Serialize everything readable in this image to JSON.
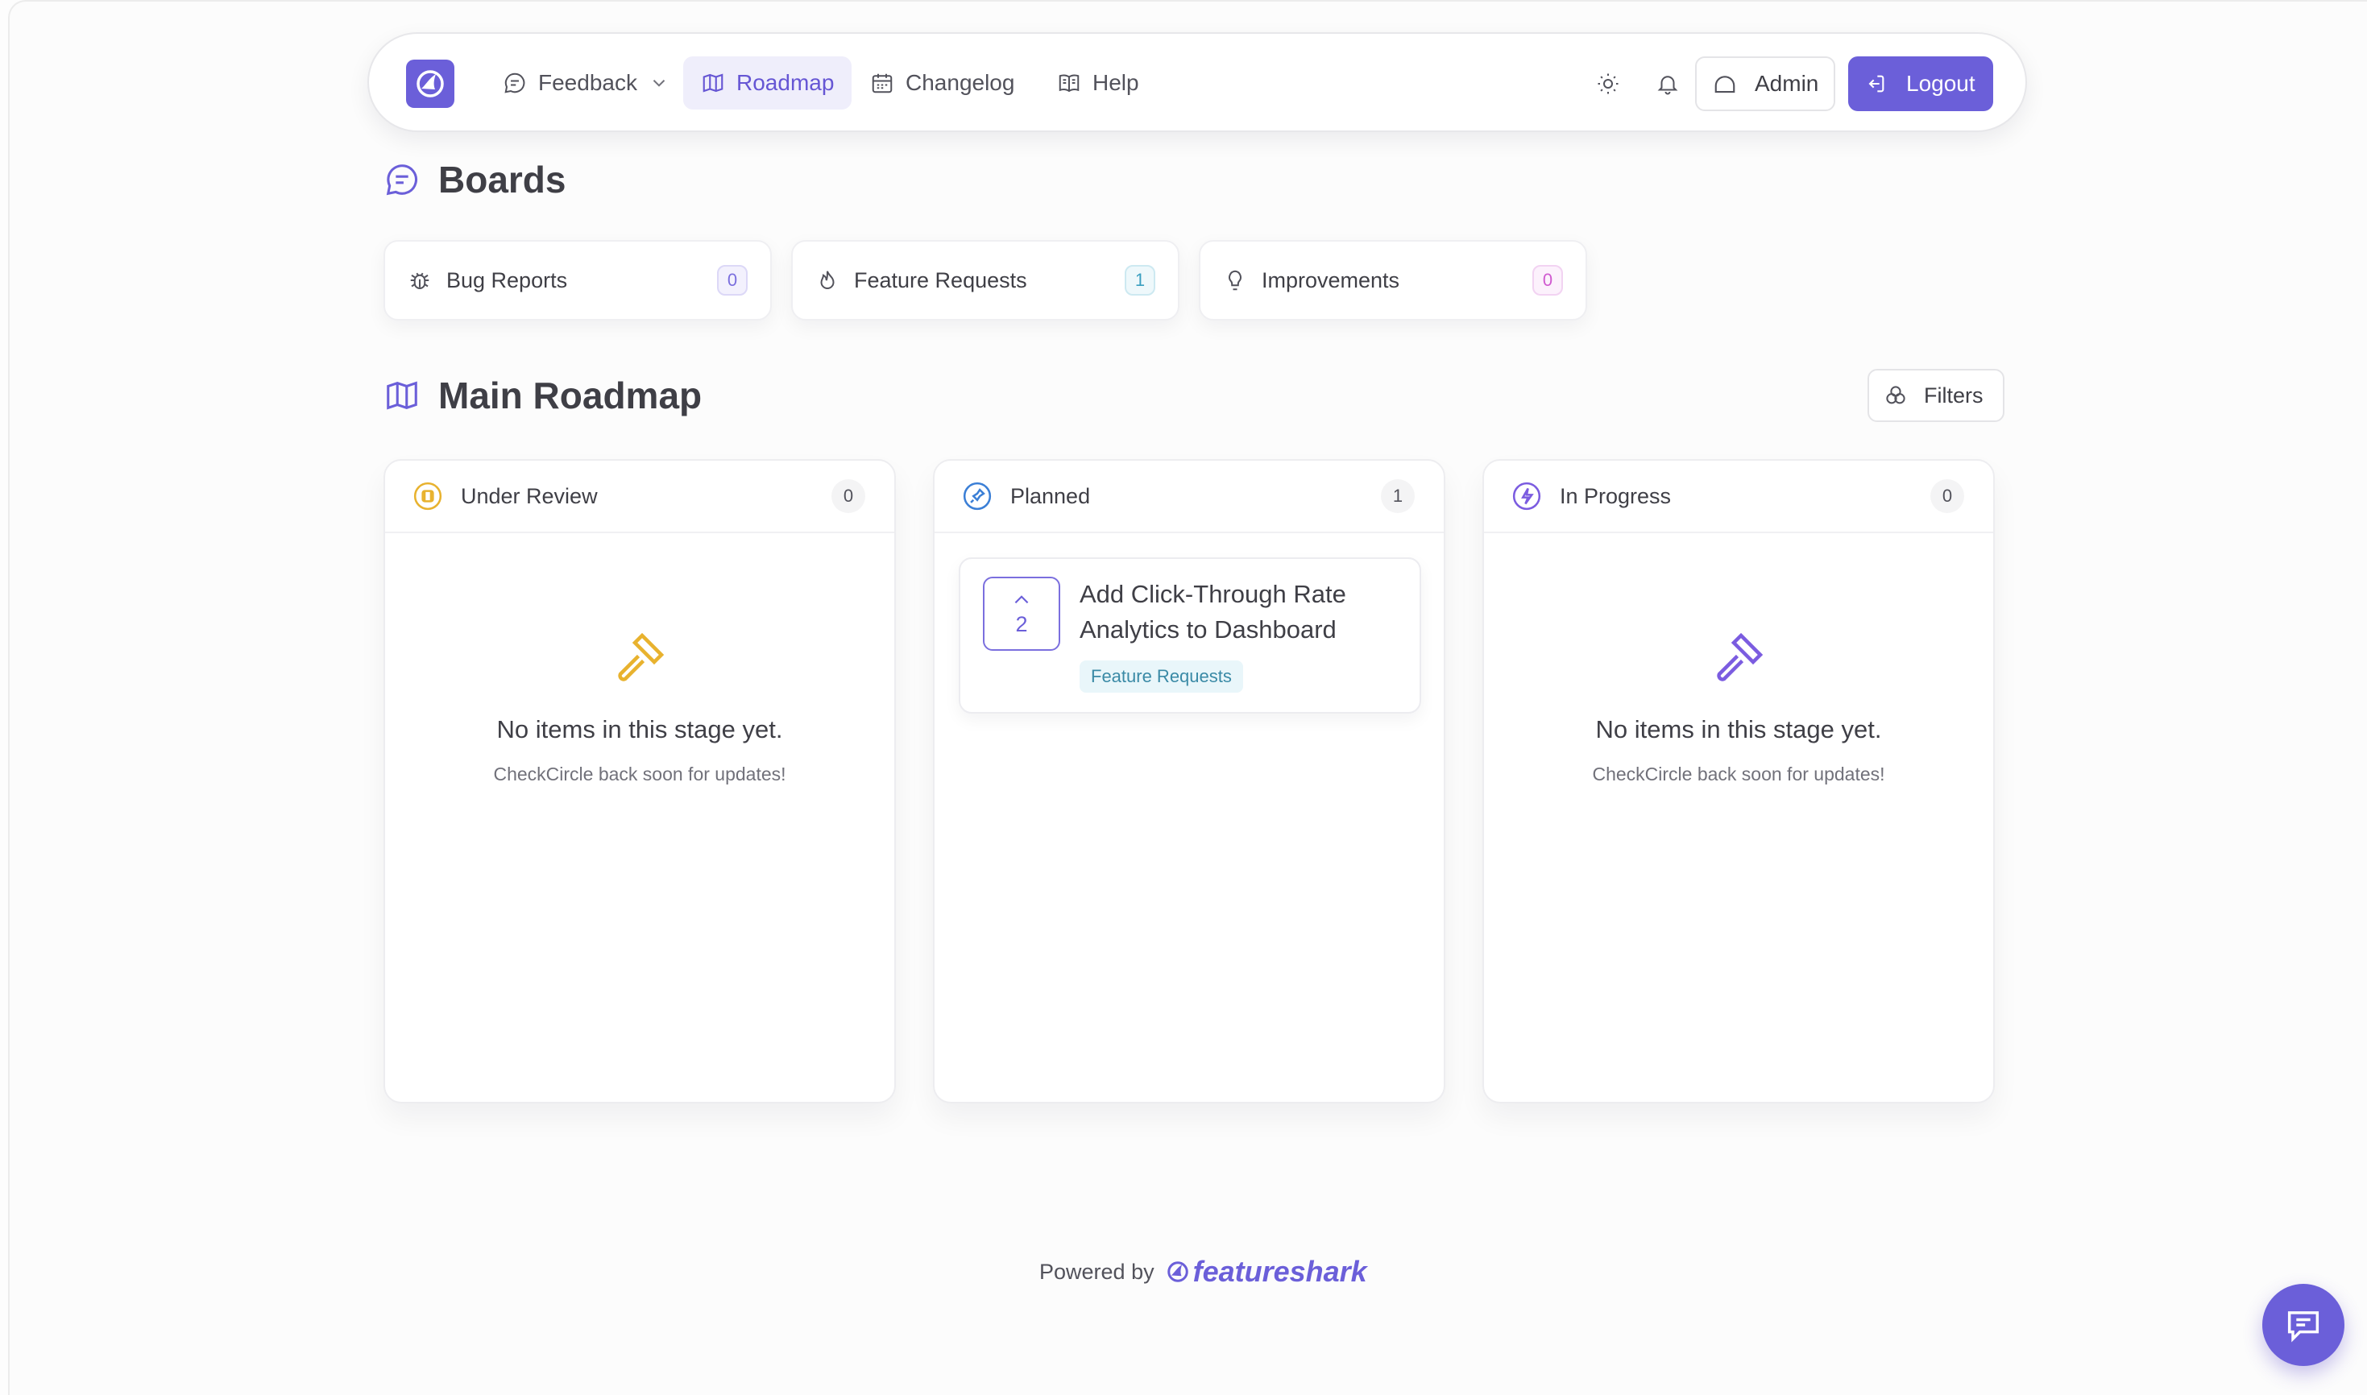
{
  "nav": {
    "items": [
      {
        "label": "Feedback",
        "icon": "chat-bubble-icon",
        "has_dropdown": true,
        "active": false
      },
      {
        "label": "Roadmap",
        "icon": "map-icon",
        "active": true
      },
      {
        "label": "Changelog",
        "icon": "calendar-icon",
        "active": false
      },
      {
        "label": "Help",
        "icon": "book-icon",
        "active": false
      }
    ],
    "admin_label": "Admin",
    "logout_label": "Logout"
  },
  "boards": {
    "title": "Boards",
    "items": [
      {
        "label": "Bug Reports",
        "icon": "bug-icon",
        "count": "0",
        "badge_color": "#7b6fde"
      },
      {
        "label": "Feature Requests",
        "icon": "flame-icon",
        "count": "1",
        "badge_color": "#3a9fc0"
      },
      {
        "label": "Improvements",
        "icon": "lightbulb-icon",
        "count": "0",
        "badge_color": "#d05ad0"
      }
    ]
  },
  "roadmap": {
    "title": "Main Roadmap",
    "filters_label": "Filters",
    "columns": [
      {
        "title": "Under Review",
        "count": "0",
        "icon_color": "#e8b22e",
        "empty_message": "No items in this stage yet.",
        "empty_sub": "CheckCircle back soon for updates!"
      },
      {
        "title": "Planned",
        "count": "1",
        "icon_color": "#3b7fd6",
        "items": [
          {
            "votes": "2",
            "title": "Add Click-Through Rate Analytics to Dashboard",
            "tag": "Feature Requests"
          }
        ]
      },
      {
        "title": "In Progress",
        "count": "0",
        "icon_color": "#7b5ce0",
        "empty_message": "No items in this stage yet.",
        "empty_sub": "CheckCircle back soon for updates!"
      }
    ]
  },
  "footer": {
    "powered_by": "Powered by",
    "brand": "featureshark"
  },
  "colors": {
    "accent": "#6b5fd9",
    "accent_soft": "#efeefb"
  }
}
